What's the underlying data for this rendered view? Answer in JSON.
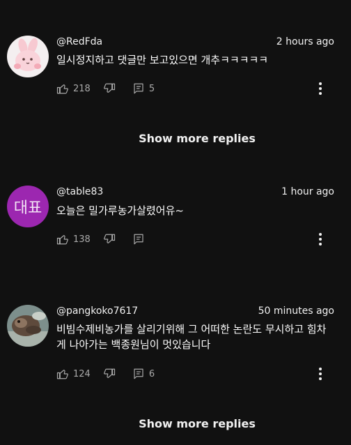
{
  "comments": [
    {
      "author": "@RedFda",
      "time": "2 hours ago",
      "text": "일시정지하고 댓글만 보고있으면 개추ㅋㅋㅋㅋㅋ",
      "likes": "218",
      "replies": "5",
      "avatar_icon": "bunny-cartoon-avatar"
    },
    {
      "author": "@table83",
      "time": "1 hour ago",
      "text": "오늘은 밀가루농가살렸어유~",
      "likes": "138",
      "replies": "",
      "avatar_initials": "대표",
      "avatar_color": "#9c27b0"
    },
    {
      "author": "@pangkoko7617",
      "time": "50 minutes ago",
      "text": "비빔수제비농가를 살리기위해 그 어떠한 논란도 무시하고 힘차게 나아가는 백종원님이 멋있습니다",
      "likes": "124",
      "replies": "6",
      "avatar_icon": "photo-avatar"
    }
  ],
  "show_more_label": "Show more replies",
  "colors": {
    "background": "#111111",
    "text_primary": "#f1f1f1",
    "text_secondary": "#aaaaaa"
  }
}
